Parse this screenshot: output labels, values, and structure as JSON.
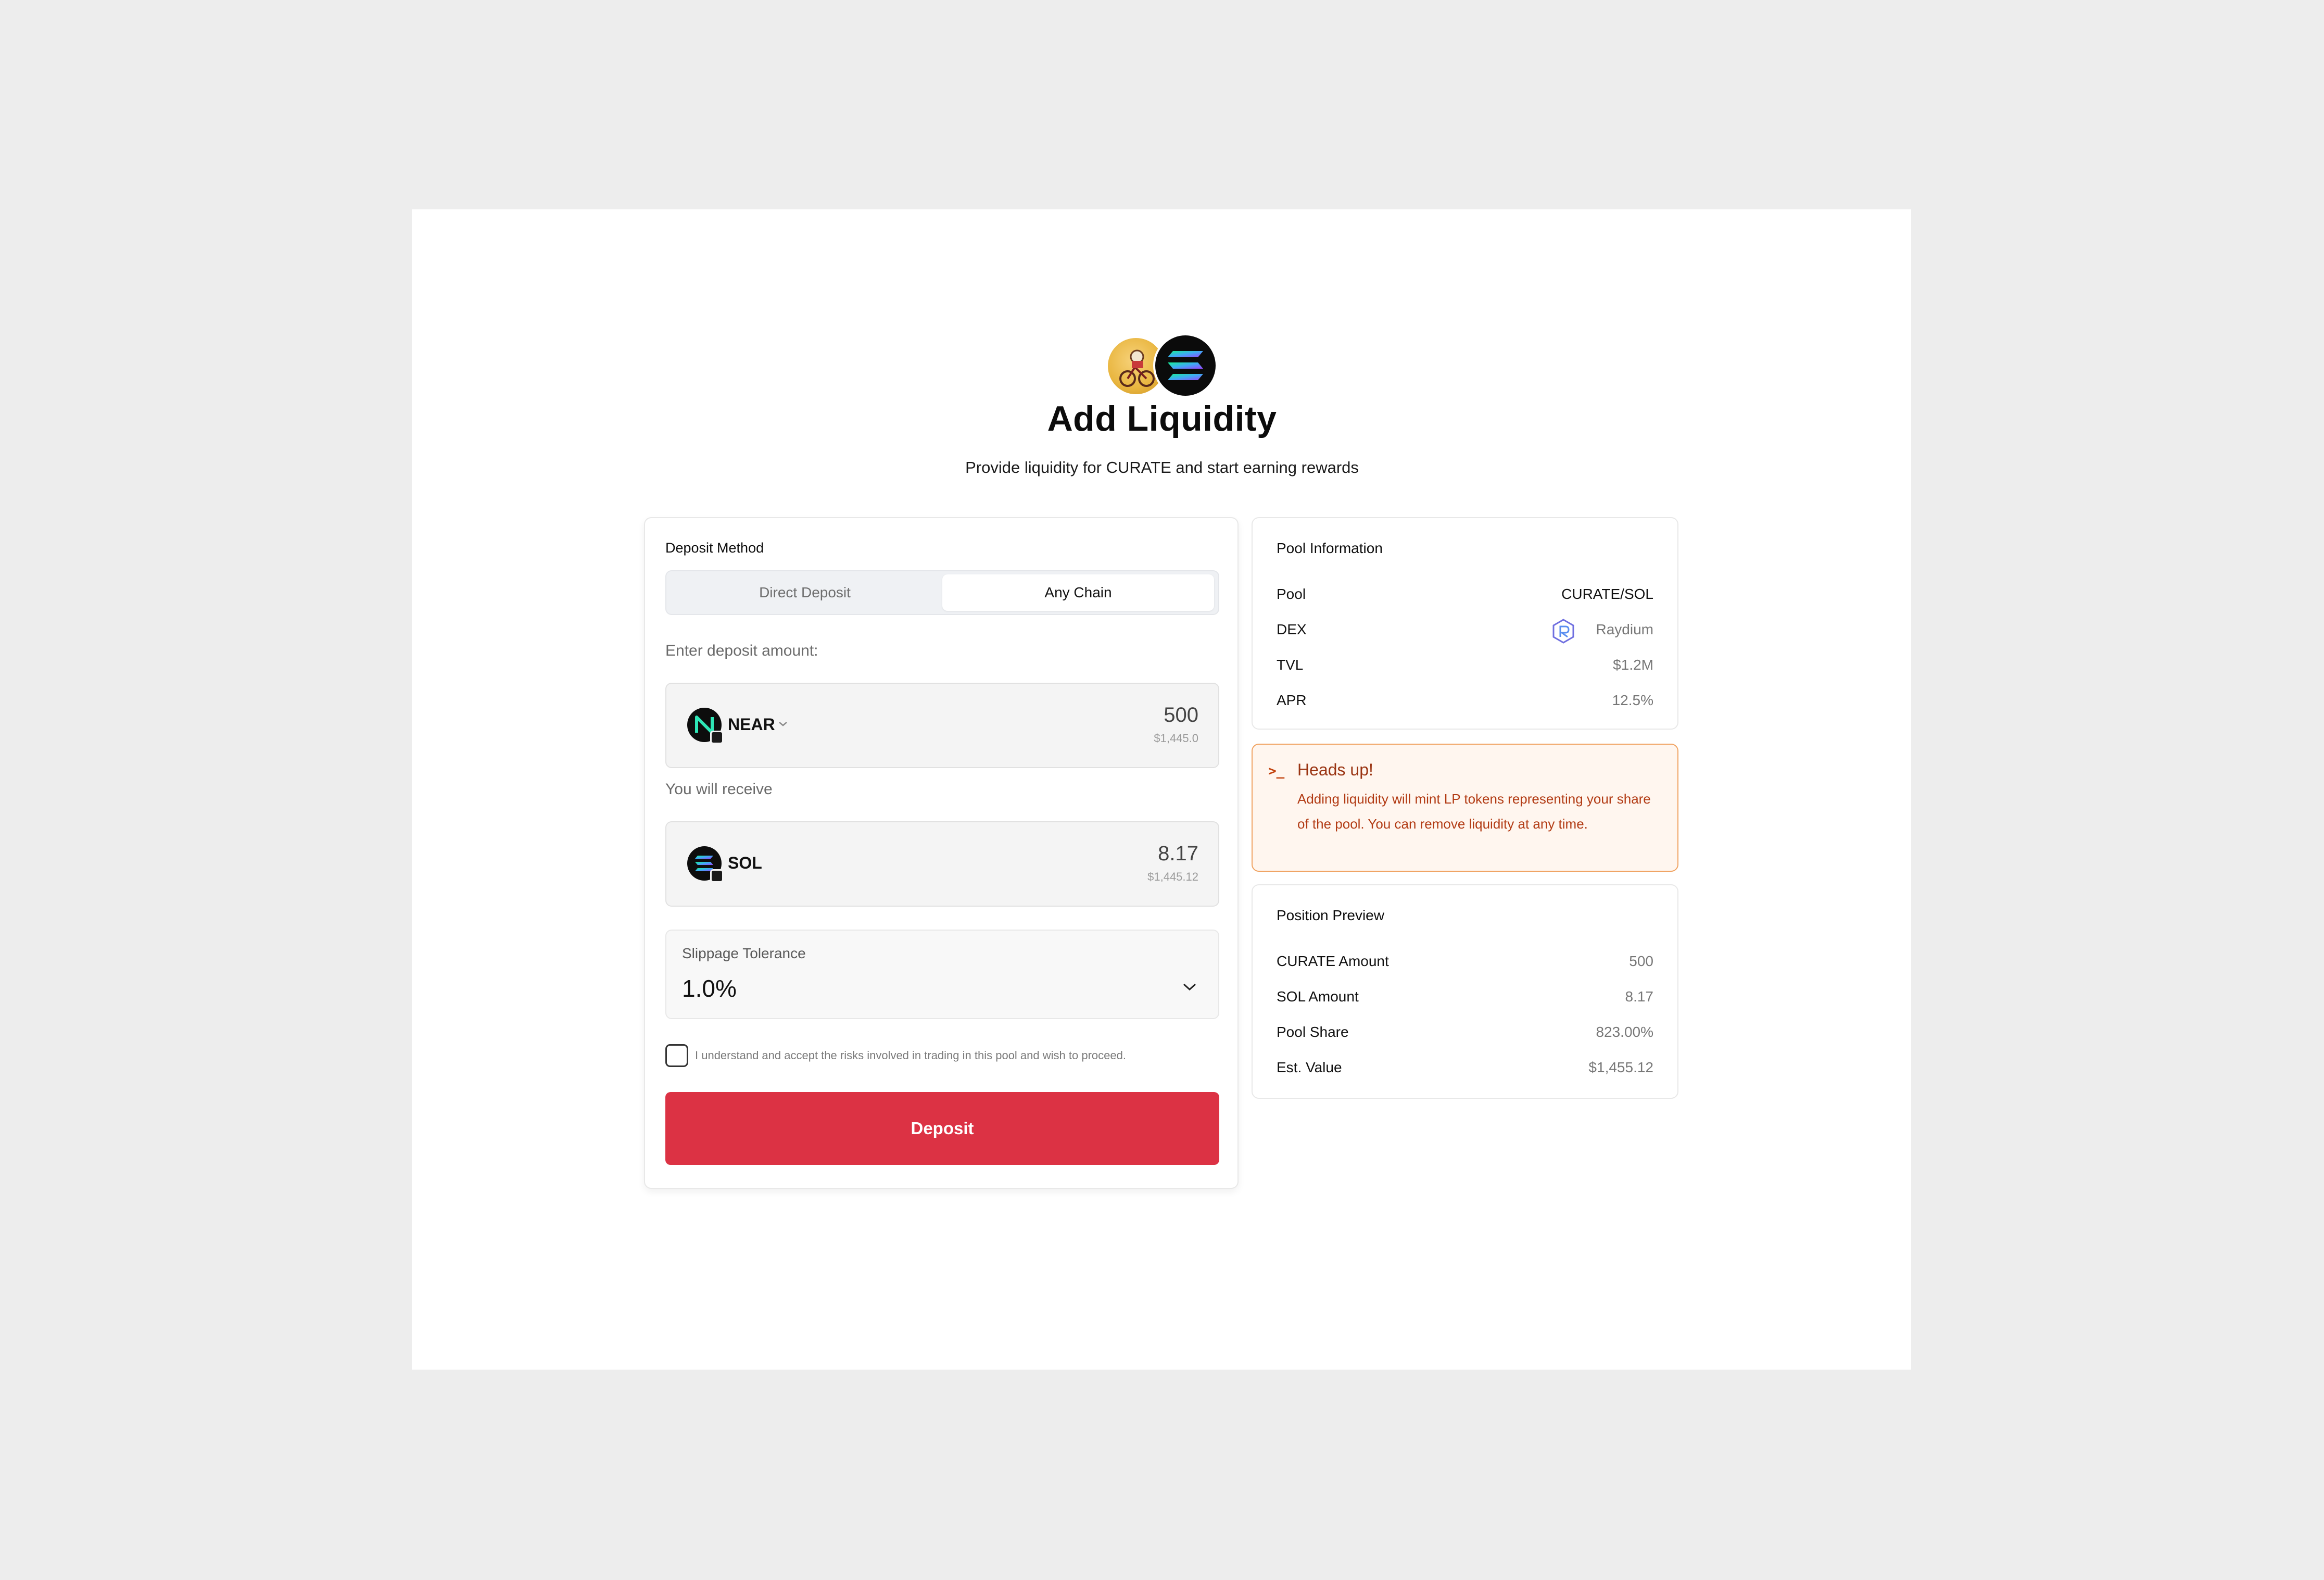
{
  "header": {
    "title": "Add Liquidity",
    "subtitle": "Provide liquidity for CURATE and start earning rewards",
    "token_icons": [
      "curate-token-icon",
      "sol-token-icon"
    ]
  },
  "deposit_form": {
    "method_label": "Deposit Method",
    "methods": [
      {
        "label": "Direct Deposit",
        "selected": false
      },
      {
        "label": "Any Chain",
        "selected": true
      }
    ],
    "enter_amount_label": "Enter deposit amount:",
    "from": {
      "token": "NEAR",
      "amount": "500",
      "usd": "$1,445.0"
    },
    "receive_label": "You will receive",
    "to": {
      "token": "SOL",
      "amount": "8.17",
      "usd": "$1,445.12"
    },
    "slippage": {
      "label": "Slippage Tolerance",
      "value": "1.0%"
    },
    "risk_text": "I understand and accept the risks involved in trading in this pool and wish to proceed.",
    "risk_checked": false,
    "deposit_button": "Deposit"
  },
  "pool_info": {
    "title": "Pool Information",
    "rows": [
      {
        "key": "Pool",
        "value": "CURATE/SOL"
      },
      {
        "key": "DEX",
        "value": "Raydium"
      },
      {
        "key": "TVL",
        "value": "$1.2M"
      },
      {
        "key": "APR",
        "value": "12.5%"
      }
    ]
  },
  "alert": {
    "icon": ">_",
    "title": "Heads up!",
    "body": "Adding liquidity will mint LP tokens representing your share of the pool. You can remove liquidity at any time."
  },
  "position_preview": {
    "title": "Position Preview",
    "rows": [
      {
        "key": "CURATE Amount",
        "value": "500"
      },
      {
        "key": "SOL Amount",
        "value": "8.17"
      },
      {
        "key": "Pool Share",
        "value": "823.00%"
      },
      {
        "key": "Est. Value",
        "value": "$1,455.12"
      }
    ]
  },
  "colors": {
    "page_bg": "#ededed",
    "deposit_button": "#dc3244",
    "alert_border": "#f0a464",
    "alert_bg": "#fff6ef",
    "alert_text": "#b23b14",
    "near_accent": "#2ee6b6",
    "sol_gradient": [
      "#14f195",
      "#3fa9f5",
      "#9945ff"
    ]
  }
}
